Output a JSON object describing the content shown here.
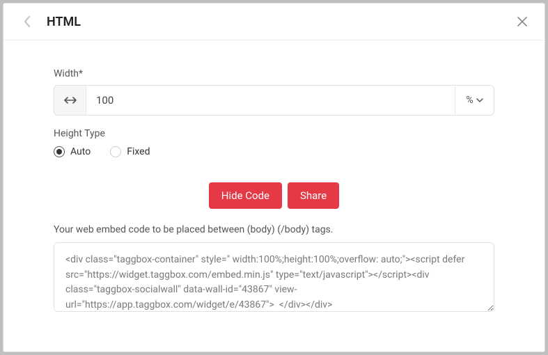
{
  "header": {
    "title": "HTML"
  },
  "form": {
    "widthLabel": "Width*",
    "widthValue": "100",
    "widthUnit": "%",
    "heightTypeLabel": "Height Type",
    "radioOptions": {
      "auto": "Auto",
      "fixed": "Fixed"
    },
    "selectedRadio": "auto"
  },
  "buttons": {
    "hideCode": "Hide Code",
    "share": "Share"
  },
  "embed": {
    "helpText": "Your web embed code to be placed between (body) (/body) tags.",
    "code": "<div class=\"taggbox-container\" style=\" width:100%;height:100%;overflow: auto;\"><script defer src=\"https://widget.taggbox.com/embed.min.js\" type=\"text/javascript\"></script><div class=\"taggbox-socialwall\" data-wall-id=\"43867\" view-url=\"https://app.taggbox.com/widget/e/43867\">  </div></div>"
  }
}
